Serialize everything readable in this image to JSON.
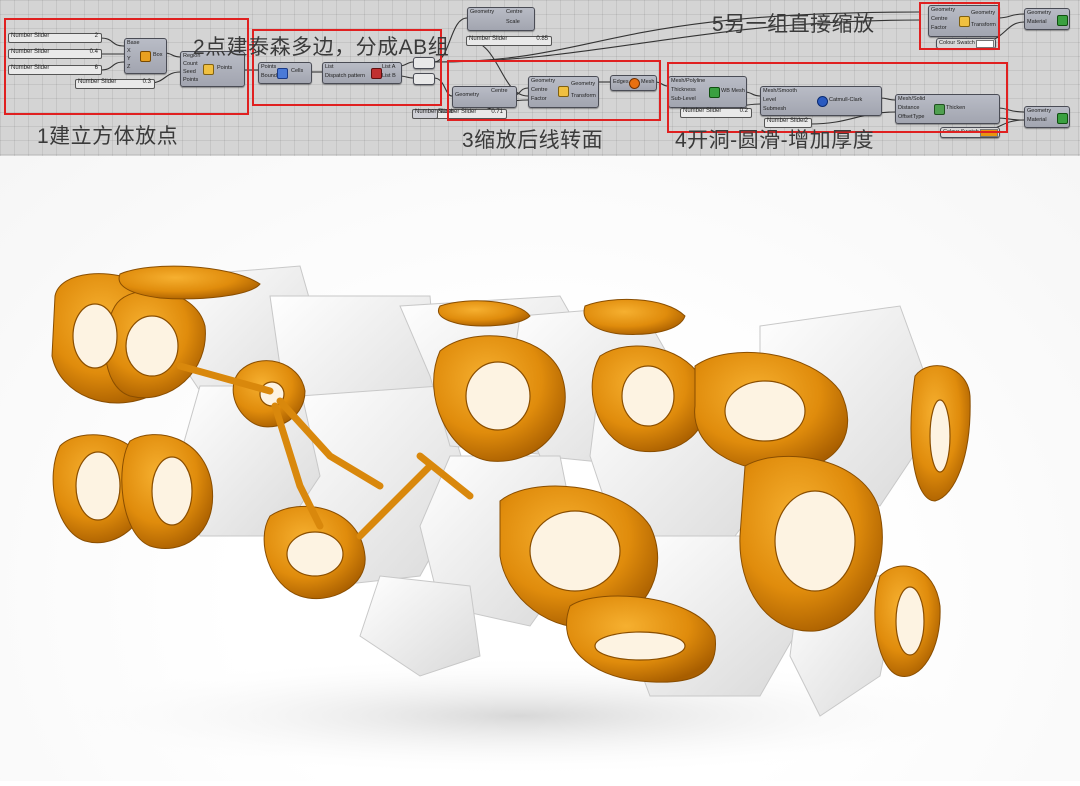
{
  "canvas": {
    "sliders": [
      {
        "label": "Number Slider",
        "value": "2"
      },
      {
        "label": "Number Slider",
        "value": "0.4"
      },
      {
        "label": "Number Slider",
        "value": "6"
      },
      {
        "label": "Number Slider",
        "value": "0.3"
      },
      {
        "label": "Number Slider",
        "value": "0.85"
      },
      {
        "label": "Number Slider",
        "value": "0.71"
      },
      {
        "label": "Number Slider",
        "value": "0.2"
      },
      {
        "label": "Number Slider",
        "value": "2"
      },
      {
        "label": "Number Slider",
        "value": "0.5"
      }
    ],
    "components": {
      "box_inputs": [
        "Base",
        "X",
        "Y",
        "Z"
      ],
      "box_output": "Box",
      "populate_inputs": [
        "Region",
        "Count",
        "Seed",
        "Points"
      ],
      "populate_output": "Points",
      "voronoi_inputs": [
        "Points",
        "Boundary"
      ],
      "voronoi_output": "Cells",
      "dispatch_inputs": [
        "List",
        "Dispatch pattern"
      ],
      "dispatch_outputs": [
        "List A",
        "List B"
      ],
      "scale_top_inputs": [
        "Geometry",
        "Centre"
      ],
      "scale_top_label": "Scale",
      "scale_mid_inputs": [
        "Geometry",
        "Centre",
        "Factor"
      ],
      "scale_mid_outputs": [
        "Geometry",
        "Transform"
      ],
      "edges_label": "Edges",
      "mesh_label": "Mesh",
      "mesh_pipe_inputs": [
        "Mesh/Polyline",
        "Thickness",
        "Sub-Level"
      ],
      "mesh_pipe_label": "WB Mesh",
      "smooth_inputs": [
        "Mesh/Smooth",
        "Level",
        "Submesh"
      ],
      "smooth_label": "Catmull-Clark",
      "thicken_inputs": [
        "Mesh/Solid",
        "Distance",
        "OffsetType"
      ],
      "thicken_label": "Thicken",
      "scale_right_inputs": [
        "Geometry",
        "Centre",
        "Factor"
      ],
      "scale_right_outputs": [
        "Geometry",
        "Transform"
      ],
      "preview_inputs": [
        "Geometry",
        "Material"
      ],
      "colour_swatch_label": "Colour Swatch"
    }
  },
  "annotations": {
    "step1": "1建立方体放点",
    "step2": "2点建泰森多边，分成AB组",
    "step3": "3缩放后线转面",
    "step4": "4开洞-圆滑-增加厚度",
    "step5": "5另一组直接缩放"
  },
  "colors": {
    "highlight_box": "#e02020",
    "orange_geometry": "#e8950f",
    "white_geometry": "#f2f2f2",
    "canvas_bg": "#d4d4d4",
    "component_fill": "#a9acb6"
  },
  "render": {
    "description_icon": "3d-voronoi-lattice-render"
  }
}
